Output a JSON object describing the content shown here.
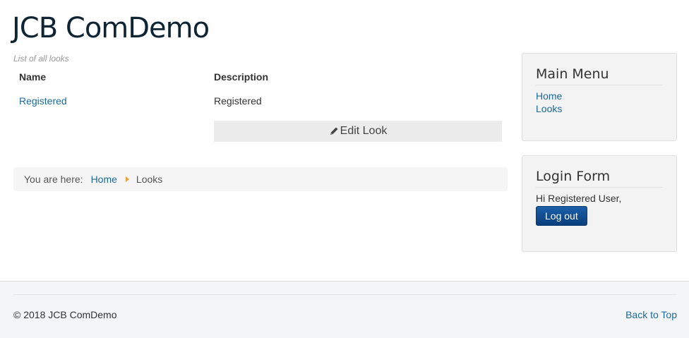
{
  "site": {
    "title": "JCB ComDemo"
  },
  "page": {
    "subtitle": "List of all looks"
  },
  "table": {
    "headers": [
      "Name",
      "Description"
    ],
    "rows": [
      {
        "name": "Registered",
        "description": "Registered"
      }
    ],
    "edit_label": "Edit Look"
  },
  "breadcrumb": {
    "label": "You are here:",
    "home": "Home",
    "current": "Looks"
  },
  "main_menu": {
    "title": "Main Menu",
    "items": [
      "Home",
      "Looks"
    ]
  },
  "login_form": {
    "title": "Login Form",
    "greeting": "Hi Registered User,",
    "logout_label": "Log out"
  },
  "footer": {
    "copyright": "© 2018 JCB ComDemo",
    "back_to_top": "Back to Top"
  },
  "colors": {
    "title": "#0e2433",
    "link": "#1d6a9a",
    "logout_button": "#0c4e92",
    "breadcrumb_separator": "#e8a33a"
  },
  "icons": {
    "edit": "pencil-icon"
  }
}
